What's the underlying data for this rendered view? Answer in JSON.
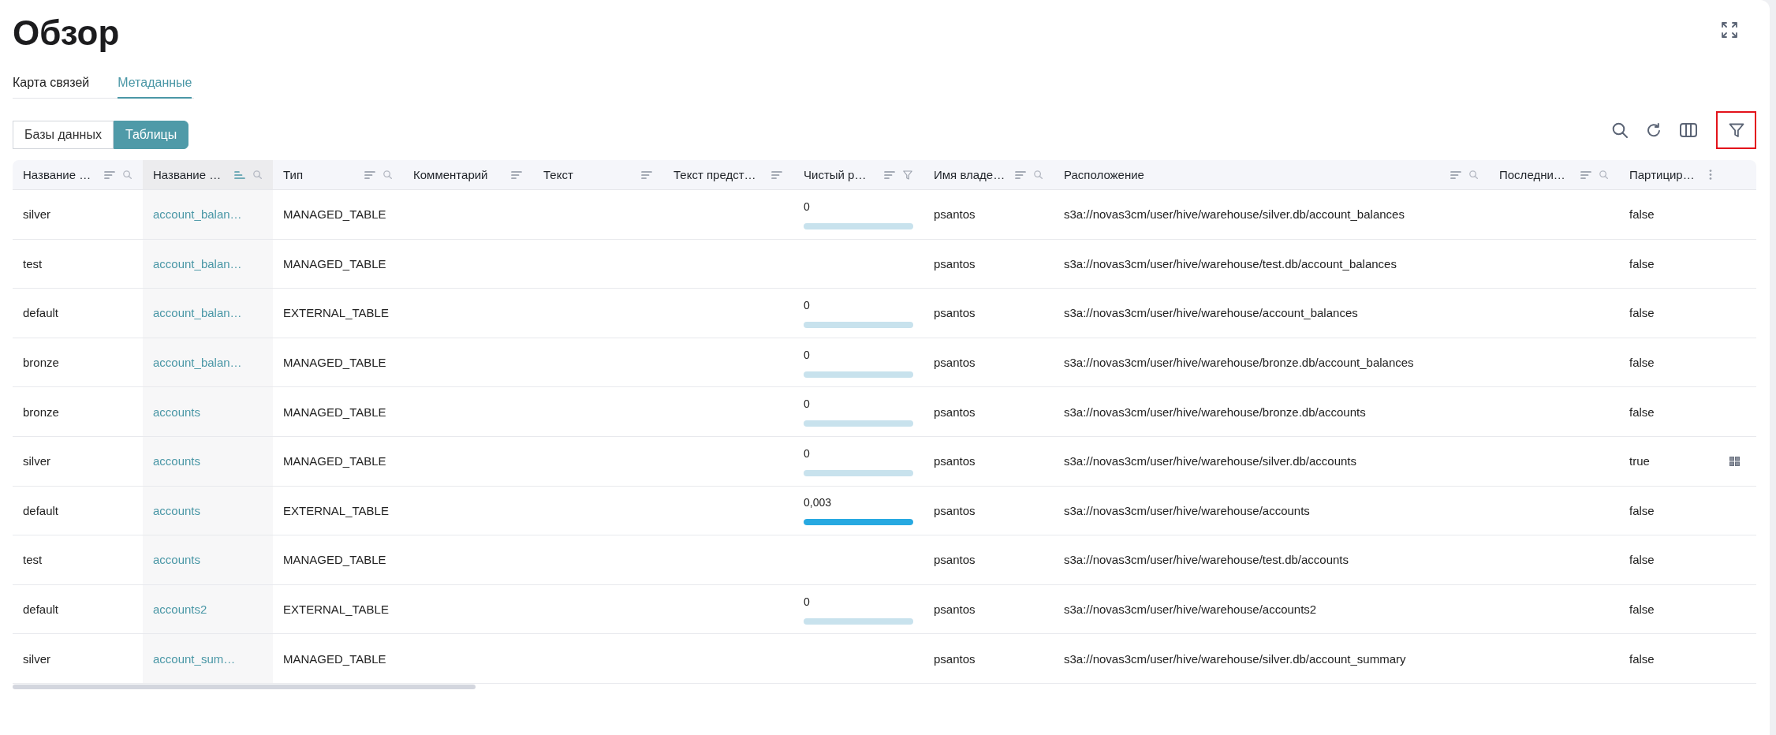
{
  "page": {
    "title": "Обзор"
  },
  "tabs": [
    {
      "label": "Карта связей",
      "selected": false
    },
    {
      "label": "Метаданные",
      "selected": true
    }
  ],
  "view_switch": [
    {
      "label": "Базы данных",
      "selected": false
    },
    {
      "label": "Таблицы",
      "selected": true
    }
  ],
  "toolbar": [
    {
      "kind": "search",
      "highlighted": false
    },
    {
      "kind": "refresh",
      "highlighted": false
    },
    {
      "kind": "columns",
      "highlighted": false
    },
    {
      "kind": "filter",
      "highlighted": true
    }
  ],
  "table": {
    "columns": [
      {
        "label": "Название …",
        "kind": "text",
        "sorted": false,
        "sortable": true,
        "searchable": true,
        "filterable": false,
        "menu": false
      },
      {
        "label": "Название …",
        "kind": "link",
        "sorted": true,
        "sortable": true,
        "searchable": true,
        "filterable": false,
        "menu": false
      },
      {
        "label": "Тип",
        "kind": "text",
        "sorted": false,
        "sortable": true,
        "searchable": true,
        "filterable": false,
        "menu": false
      },
      {
        "label": "Комментарий",
        "sorted": false,
        "sortable": true,
        "searchable": false,
        "filterable": false,
        "menu": false
      },
      {
        "label": "Текст",
        "sorted": false,
        "sortable": true,
        "searchable": false,
        "filterable": false,
        "menu": false
      },
      {
        "label": "Текст предст…",
        "sorted": false,
        "sortable": true,
        "searchable": false,
        "filterable": false,
        "menu": false
      },
      {
        "label": "Чистый р…",
        "kind": "meter",
        "sorted": false,
        "sortable": true,
        "searchable": false,
        "filterable": true,
        "menu": false
      },
      {
        "label": "Имя владе…",
        "kind": "text",
        "sorted": false,
        "sortable": true,
        "searchable": true,
        "filterable": false,
        "menu": false
      },
      {
        "label": "Расположение",
        "kind": "text",
        "sorted": false,
        "sortable": true,
        "searchable": true,
        "filterable": false,
        "menu": false
      },
      {
        "label": "Последни…",
        "sorted": false,
        "sortable": true,
        "searchable": true,
        "filterable": false,
        "menu": false
      },
      {
        "label": "Партицир…",
        "kind": "text",
        "sorted": false,
        "sortable": false,
        "searchable": false,
        "filterable": false,
        "menu": true
      }
    ],
    "rows": [
      {
        "column_1": "silver",
        "column_2": "account_balan…",
        "column_3": "MANAGED_TABLE",
        "column_7": {
          "value": "0",
          "level": 0
        },
        "column_8": "psantos",
        "column_9": "s3a://novas3cm/user/hive/warehouse/silver.db/account_balances",
        "column_11": "false",
        "hovered": false
      },
      {
        "column_1": "test",
        "column_2": "account_balan…",
        "column_3": "MANAGED_TABLE",
        "column_8": "psantos",
        "column_9": "s3a://novas3cm/user/hive/warehouse/test.db/account_balances",
        "column_11": "false",
        "hovered": false
      },
      {
        "column_1": "default",
        "column_2": "account_balan…",
        "column_3": "EXTERNAL_TABLE",
        "column_7": {
          "value": "0",
          "level": 0
        },
        "column_8": "psantos",
        "column_9": "s3a://novas3cm/user/hive/warehouse/account_balances",
        "column_11": "false",
        "hovered": false
      },
      {
        "column_1": "bronze",
        "column_2": "account_balan…",
        "column_3": "MANAGED_TABLE",
        "column_7": {
          "value": "0",
          "level": 0
        },
        "column_8": "psantos",
        "column_9": "s3a://novas3cm/user/hive/warehouse/bronze.db/account_balances",
        "column_11": "false",
        "hovered": false
      },
      {
        "column_1": "bronze",
        "column_2": "accounts",
        "column_3": "MANAGED_TABLE",
        "column_7": {
          "value": "0",
          "level": 0
        },
        "column_8": "psantos",
        "column_9": "s3a://novas3cm/user/hive/warehouse/bronze.db/accounts",
        "column_11": "false",
        "hovered": false
      },
      {
        "column_1": "silver",
        "column_2": "accounts",
        "column_3": "MANAGED_TABLE",
        "column_7": {
          "value": "0",
          "level": 0
        },
        "column_8": "psantos",
        "column_9": "s3a://novas3cm/user/hive/warehouse/silver.db/accounts",
        "column_11": "true",
        "hovered": true
      },
      {
        "column_1": "default",
        "column_2": "accounts",
        "column_3": "EXTERNAL_TABLE",
        "column_7": {
          "value": "0,003",
          "level": 1
        },
        "column_8": "psantos",
        "column_9": "s3a://novas3cm/user/hive/warehouse/accounts",
        "column_11": "false",
        "hovered": false
      },
      {
        "column_1": "test",
        "column_2": "accounts",
        "column_3": "MANAGED_TABLE",
        "column_8": "psantos",
        "column_9": "s3a://novas3cm/user/hive/warehouse/test.db/accounts",
        "column_11": "false",
        "hovered": false
      },
      {
        "column_1": "default",
        "column_2": "accounts2",
        "column_3": "EXTERNAL_TABLE",
        "column_7": {
          "value": "0",
          "level": 0
        },
        "column_8": "psantos",
        "column_9": "s3a://novas3cm/user/hive/warehouse/accounts2",
        "column_11": "false",
        "hovered": false
      },
      {
        "column_1": "silver",
        "column_2": "account_sum…",
        "column_3": "MANAGED_TABLE",
        "column_8": "psantos",
        "column_9": "s3a://novas3cm/user/hive/warehouse/silver.db/account_summary",
        "column_11": "false",
        "hovered": false
      }
    ]
  }
}
